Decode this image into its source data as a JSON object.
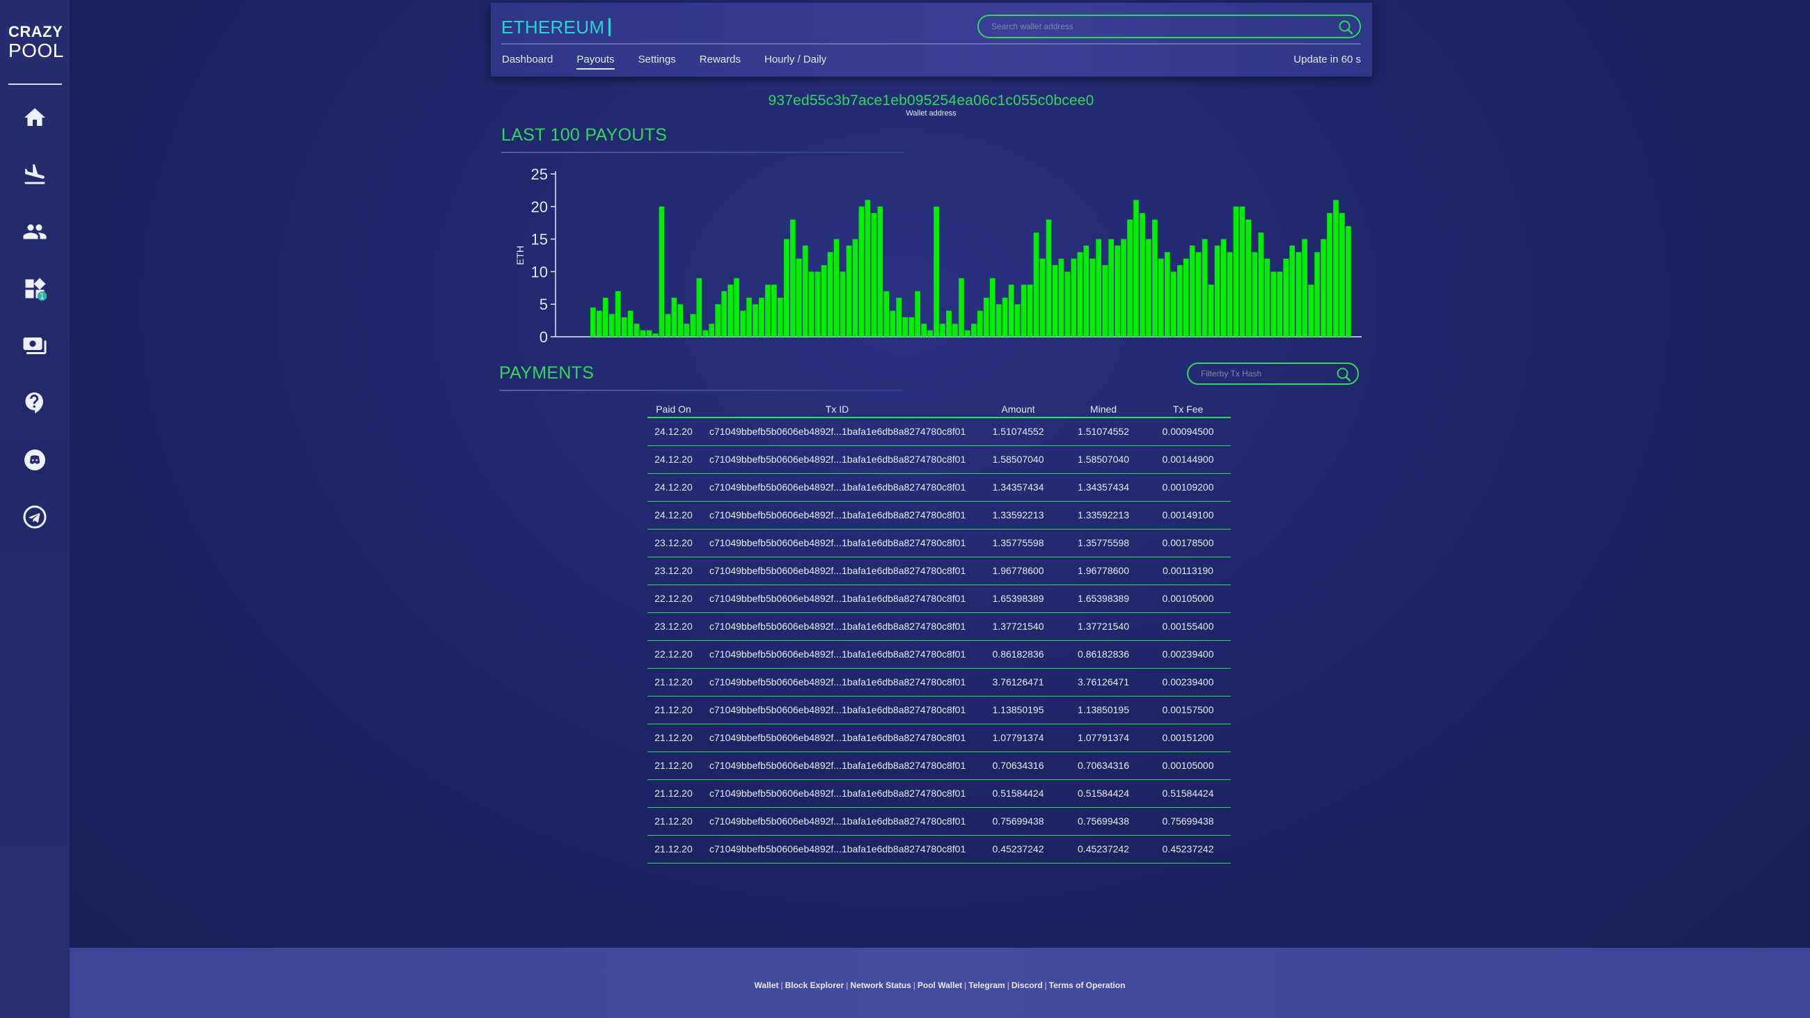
{
  "logo": {
    "line1": "CRAZY",
    "line2": "POOL"
  },
  "header": {
    "coin": "ETHEREUM",
    "search_placeholder": "Search wallet address",
    "tabs": [
      {
        "label": "Dashboard",
        "active": false
      },
      {
        "label": "Payouts",
        "active": true
      },
      {
        "label": "Settings",
        "active": false
      },
      {
        "label": "Rewards",
        "active": false
      },
      {
        "label": "Hourly / Daily",
        "active": false
      }
    ],
    "update_text": "Update in 60 s"
  },
  "sidebar": {
    "items": [
      {
        "icon": "home-icon"
      },
      {
        "icon": "airplane-landing-icon"
      },
      {
        "icon": "people-icon"
      },
      {
        "icon": "widgets-icon",
        "badge": "1"
      },
      {
        "icon": "payment-icon"
      },
      {
        "icon": "help-icon"
      },
      {
        "icon": "discord-icon"
      },
      {
        "icon": "telegram-icon"
      }
    ]
  },
  "wallet": {
    "address": "937ed55c3b7ace1eb095254ea06c1c055c0bcee0",
    "label": "Wallet address"
  },
  "payouts_section": {
    "title": "LAST 100 PAYOUTS"
  },
  "chart_data": {
    "type": "bar",
    "title": "LAST 100 PAYOUTS",
    "xlabel": "",
    "ylabel": "ETH",
    "ylim": [
      0,
      25
    ],
    "yticks": [
      0,
      5,
      10,
      15,
      20,
      25
    ],
    "grid": false,
    "color": "#00ee00",
    "values": [
      4.5,
      4,
      6,
      3.5,
      7,
      3,
      4,
      2,
      1,
      1,
      0.5,
      20,
      3.5,
      6,
      5,
      2,
      3.5,
      9,
      1,
      2,
      5,
      7,
      8,
      9,
      4,
      6,
      5,
      6,
      8,
      8,
      6,
      15,
      18,
      12,
      14,
      10,
      10,
      11,
      13,
      15,
      10,
      14,
      15,
      20,
      21,
      19,
      20,
      7,
      4,
      6,
      3,
      3,
      7,
      2,
      1,
      20,
      2,
      4,
      2,
      9,
      1,
      2,
      4,
      6,
      9,
      5,
      6,
      8,
      5,
      8,
      8,
      16,
      12,
      18,
      11,
      12,
      10,
      12,
      13,
      14,
      12,
      15,
      11,
      15,
      14,
      15,
      18,
      21,
      19,
      15,
      18,
      12,
      13,
      10,
      11,
      12,
      14,
      13,
      15,
      8,
      14,
      15,
      13,
      20,
      20,
      18,
      13,
      16,
      12,
      10,
      10,
      12,
      14,
      13,
      15,
      8,
      13,
      15,
      19,
      21,
      19,
      17
    ],
    "legend": "none"
  },
  "payments_section": {
    "title": "PAYMENTS",
    "filter_placeholder": "Filterby Tx Hash",
    "columns": [
      "Paid On",
      "Tx ID",
      "Amount",
      "Mined",
      "Tx Fee"
    ],
    "rows": [
      [
        "24.12.20",
        "c71049bbefb5b0606eb4892f...1bafa1e6db8a8274780c8f01",
        "1.51074552",
        "1.51074552",
        "0.00094500"
      ],
      [
        "24.12.20",
        "c71049bbefb5b0606eb4892f...1bafa1e6db8a8274780c8f01",
        "1.58507040",
        "1.58507040",
        "0.00144900"
      ],
      [
        "24.12.20",
        "c71049bbefb5b0606eb4892f...1bafa1e6db8a8274780c8f01",
        "1.34357434",
        "1.34357434",
        "0.00109200"
      ],
      [
        "24.12.20",
        "c71049bbefb5b0606eb4892f...1bafa1e6db8a8274780c8f01",
        "1.33592213",
        "1.33592213",
        "0.00149100"
      ],
      [
        "23.12.20",
        "c71049bbefb5b0606eb4892f...1bafa1e6db8a8274780c8f01",
        "1.35775598",
        "1.35775598",
        "0.00178500"
      ],
      [
        "23.12.20",
        "c71049bbefb5b0606eb4892f...1bafa1e6db8a8274780c8f01",
        "1.96778600",
        "1.96778600",
        "0.00113190"
      ],
      [
        "22.12.20",
        "c71049bbefb5b0606eb4892f...1bafa1e6db8a8274780c8f01",
        "1.65398389",
        "1.65398389",
        "0.00105000"
      ],
      [
        "23.12.20",
        "c71049bbefb5b0606eb4892f...1bafa1e6db8a8274780c8f01",
        "1.37721540",
        "1.37721540",
        "0.00155400"
      ],
      [
        "22.12.20",
        "c71049bbefb5b0606eb4892f...1bafa1e6db8a8274780c8f01",
        "0.86182836",
        "0.86182836",
        "0.00239400"
      ],
      [
        "21.12.20",
        "c71049bbefb5b0606eb4892f...1bafa1e6db8a8274780c8f01",
        "3.76126471",
        "3.76126471",
        "0.00239400"
      ],
      [
        "21.12.20",
        "c71049bbefb5b0606eb4892f...1bafa1e6db8a8274780c8f01",
        "1.13850195",
        "1.13850195",
        "0.00157500"
      ],
      [
        "21.12.20",
        "c71049bbefb5b0606eb4892f...1bafa1e6db8a8274780c8f01",
        "1.07791374",
        "1.07791374",
        "0.00151200"
      ],
      [
        "21.12.20",
        "c71049bbefb5b0606eb4892f...1bafa1e6db8a8274780c8f01",
        "0.70634316",
        "0.70634316",
        "0.00105000"
      ],
      [
        "21.12.20",
        "c71049bbefb5b0606eb4892f...1bafa1e6db8a8274780c8f01",
        "0.51584424",
        "0.51584424",
        "0.51584424"
      ],
      [
        "21.12.20",
        "c71049bbefb5b0606eb4892f...1bafa1e6db8a8274780c8f01",
        "0.75699438",
        "0.75699438",
        "0.75699438"
      ],
      [
        "21.12.20",
        "c71049bbefb5b0606eb4892f...1bafa1e6db8a8274780c8f01",
        "0.45237242",
        "0.45237242",
        "0.45237242"
      ]
    ]
  },
  "footer": {
    "links": [
      "Wallet",
      "Block Explorer",
      "Network Status",
      "Pool Wallet",
      "Telegram",
      "Discord",
      "Terms of Operation"
    ]
  },
  "colors": {
    "accent_green": "#2fd85c",
    "bar_green": "#00ee00",
    "title_cyan": "#27d3d3",
    "background": "#1e2466",
    "sidebar": "#262c6e",
    "footer": "#444c9f"
  }
}
